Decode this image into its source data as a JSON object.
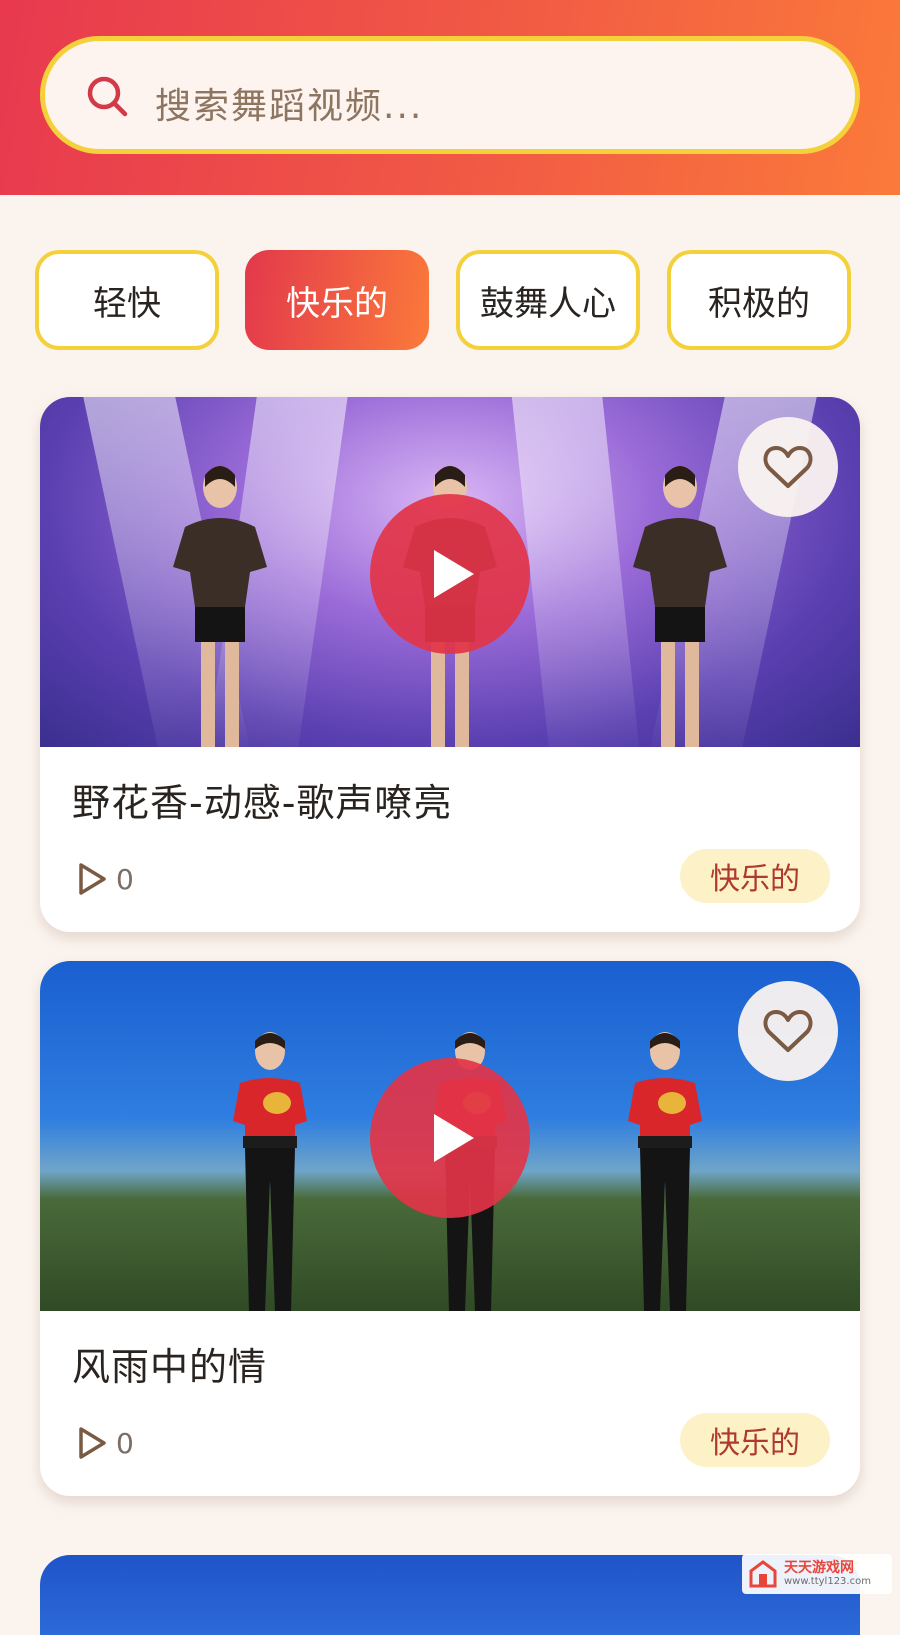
{
  "search": {
    "placeholder": "搜索舞蹈视频..."
  },
  "tags": [
    {
      "label": "轻快",
      "active": false
    },
    {
      "label": "快乐的",
      "active": true
    },
    {
      "label": "鼓舞人心",
      "active": false
    },
    {
      "label": "积极的",
      "active": false
    }
  ],
  "videos": [
    {
      "title": "野花香-动感-歌声嘹亮",
      "plays": "0",
      "category": "快乐的"
    },
    {
      "title": "风雨中的情",
      "plays": "0",
      "category": "快乐的"
    }
  ],
  "watermark": {
    "text": "天天游戏网",
    "url": "www.ttyl123.com"
  },
  "colors": {
    "header_start": "#e8394f",
    "header_end": "#fb7a3a",
    "tag_border": "#f4d03a",
    "play_button": "#e23448",
    "badge_bg": "#fdf1c8",
    "badge_text": "#b0392f"
  },
  "icons": [
    "search-icon",
    "play-icon",
    "heart-icon",
    "play-count-icon"
  ]
}
